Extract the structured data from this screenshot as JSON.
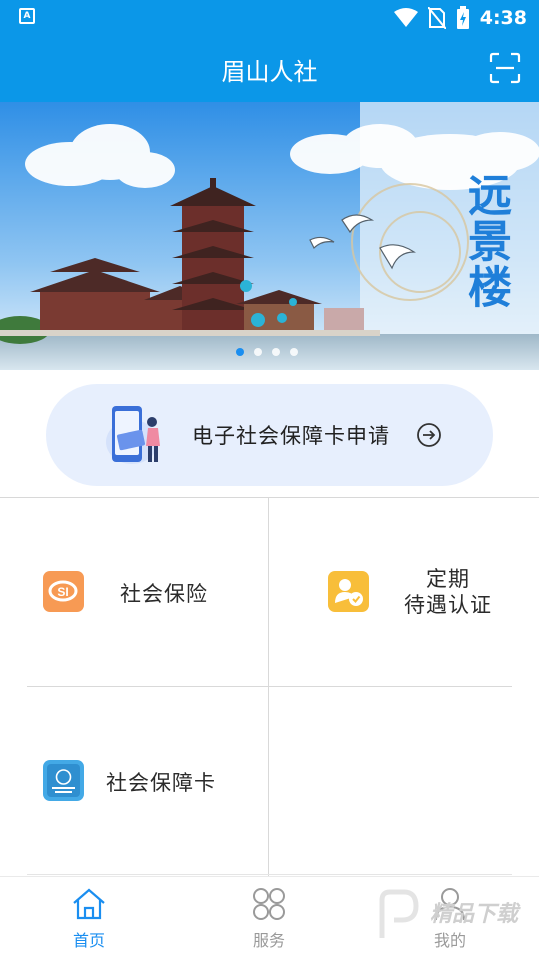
{
  "status_bar": {
    "time": "4:38"
  },
  "header": {
    "title": "眉山人社"
  },
  "banner": {
    "caption_chars": [
      "远",
      "景",
      "楼"
    ],
    "page_count": 4,
    "active_page": 1
  },
  "apply_card": {
    "label": "电子社会保障卡申请"
  },
  "services": [
    {
      "label": "社会保险",
      "icon": "social-insurance-icon",
      "color": "#f79a54"
    },
    {
      "label_line1": "定期",
      "label_line2": "待遇认证",
      "icon": "benefit-certification-icon",
      "color": "#f8be3a"
    },
    {
      "label": "社会保障卡",
      "icon": "social-security-card-icon",
      "color": "#43a9e6"
    }
  ],
  "tabbar": {
    "tabs": [
      {
        "label": "首页",
        "icon": "home-icon",
        "active": true
      },
      {
        "label": "服务",
        "icon": "grid-services-icon",
        "active": false
      },
      {
        "label": "我的",
        "icon": "person-icon",
        "active": false
      }
    ]
  },
  "watermark": {
    "text": "精品下载"
  },
  "colors": {
    "primary": "#0b97e8",
    "tab_active": "#1a8ef0",
    "pill_bg": "#e7effd"
  }
}
